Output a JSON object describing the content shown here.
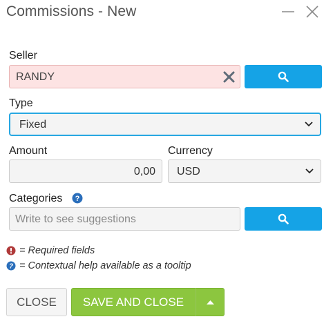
{
  "dialog": {
    "title": "Commissions - New",
    "minimize_icon": "minimize-icon",
    "close_icon": "close-icon"
  },
  "seller": {
    "label": "Seller",
    "value": "RANDY",
    "clear_icon": "clear-x-icon",
    "search_icon": "search-icon"
  },
  "type": {
    "label": "Type",
    "selected": "Fixed"
  },
  "amount": {
    "label": "Amount",
    "value": "0,00"
  },
  "currency": {
    "label": "Currency",
    "selected": "USD"
  },
  "categories": {
    "label": "Categories",
    "placeholder": "Write to see suggestions",
    "help_icon": "help-icon",
    "search_icon": "search-icon"
  },
  "legend": {
    "required": "= Required fields",
    "help": "= Contextual help available as a tooltip"
  },
  "buttons": {
    "close": "CLOSE",
    "save_and_close": "SAVE AND CLOSE"
  },
  "colors": {
    "accent_blue": "#15a3e6",
    "save_green": "#8cc63f",
    "required_red": "#c0392b",
    "help_blue": "#2a6ebb",
    "seller_error_bg": "#fde3e3"
  }
}
